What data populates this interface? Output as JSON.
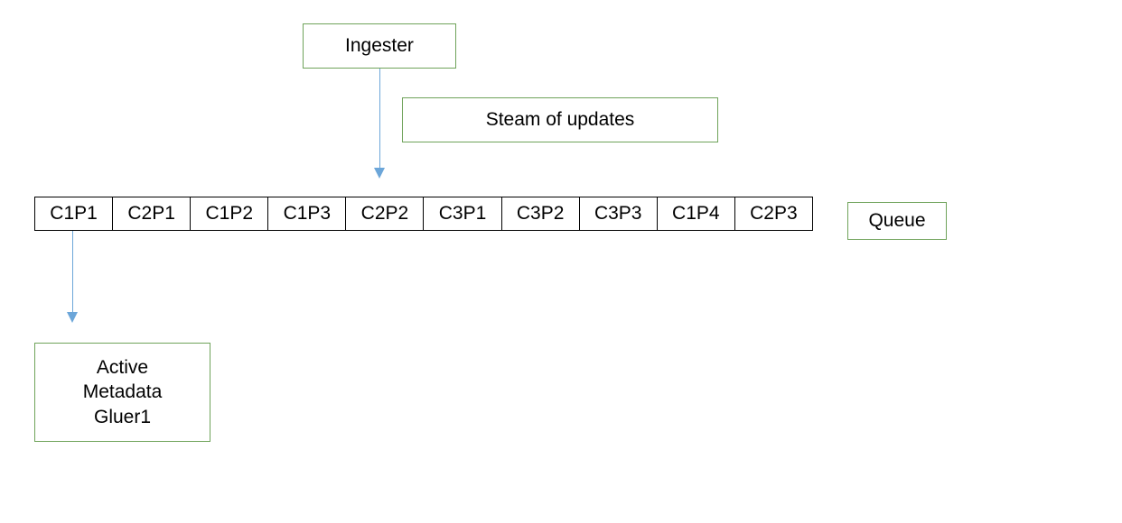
{
  "ingester": {
    "label": "Ingester"
  },
  "stream": {
    "label": "Steam of updates"
  },
  "queue": {
    "label": "Queue",
    "cells": [
      "C1P1",
      "C2P1",
      "C1P2",
      "C1P3",
      "C2P2",
      "C3P1",
      "C3P2",
      "C3P3",
      "C1P4",
      "C2P3"
    ]
  },
  "gluer": {
    "line1": "Active",
    "line2": "Metadata",
    "line3": "Gluer1"
  }
}
